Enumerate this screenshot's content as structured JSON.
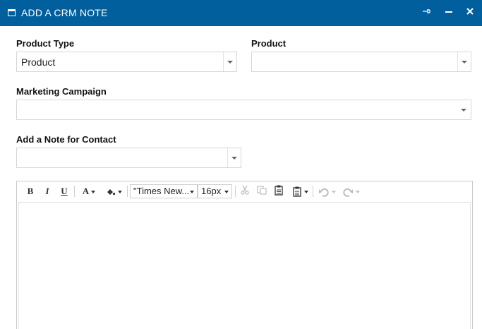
{
  "window": {
    "title": "ADD A CRM NOTE"
  },
  "form": {
    "product_type_label": "Product Type",
    "product_type_value": "Product",
    "product_label": "Product",
    "product_value": "",
    "marketing_campaign_label": "Marketing Campaign",
    "marketing_campaign_value": "",
    "note_for_contact_label": "Add a Note for Contact",
    "note_for_contact_value": ""
  },
  "editor": {
    "toolbar": {
      "bold": "B",
      "italic": "I",
      "underline": "U",
      "font_color": "A",
      "font_name": "\"Times New...",
      "font_size": "16px"
    },
    "content": ""
  },
  "colors": {
    "titlebar": "#015f9e",
    "border": "#d6d6d6"
  }
}
